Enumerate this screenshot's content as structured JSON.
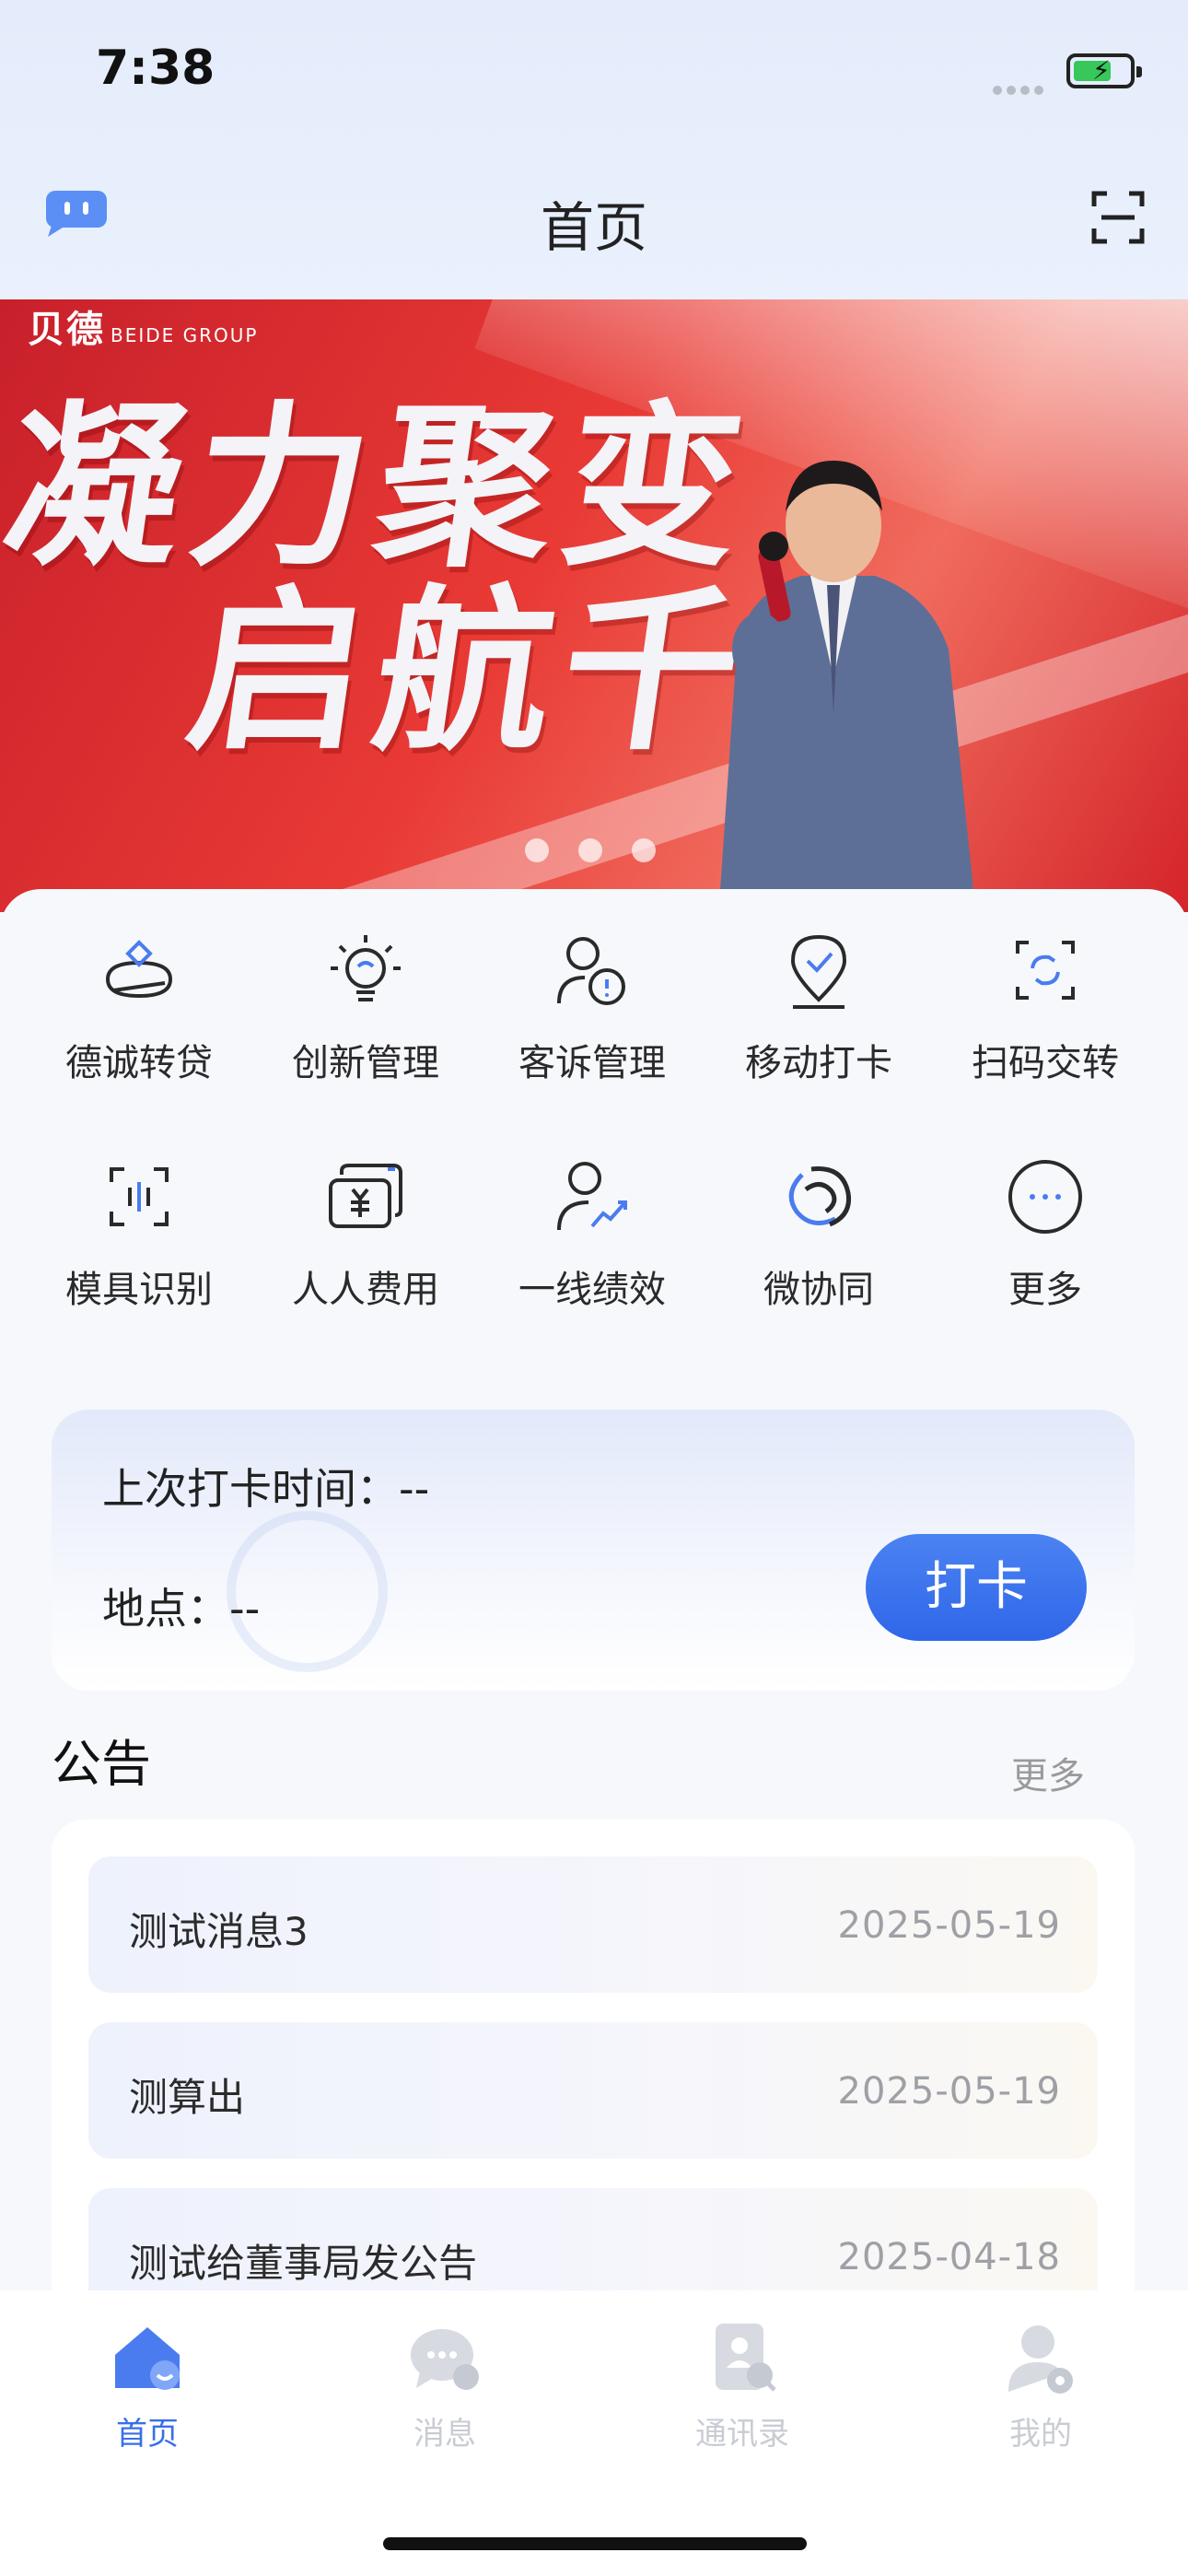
{
  "status": {
    "time": "7:38"
  },
  "header": {
    "title": "首页"
  },
  "banner": {
    "logo": "贝德",
    "logo_sub": "BEIDE GROUP",
    "line1": "凝力聚变",
    "line2": "启航千亿"
  },
  "grid": [
    {
      "label": "德诚转贷",
      "icon": "loan-icon"
    },
    {
      "label": "创新管理",
      "icon": "bulb-icon"
    },
    {
      "label": "客诉管理",
      "icon": "complaint-user-icon"
    },
    {
      "label": "移动打卡",
      "icon": "location-check-icon"
    },
    {
      "label": "扫码交转",
      "icon": "scan-transfer-icon"
    },
    {
      "label": "模具识别",
      "icon": "mold-scan-icon"
    },
    {
      "label": "人人费用",
      "icon": "expense-icon"
    },
    {
      "label": "一线绩效",
      "icon": "performance-icon"
    },
    {
      "label": "微协同",
      "icon": "collaboration-icon"
    },
    {
      "label": "更多",
      "icon": "more-icon"
    }
  ],
  "clock": {
    "last_time_label": "上次打卡时间：--",
    "location_label": "地点：--",
    "button": "打卡"
  },
  "notice": {
    "title": "公告",
    "more": "更多",
    "items": [
      {
        "title": "测试消息3",
        "date": "2025-05-19"
      },
      {
        "title": "测算出",
        "date": "2025-05-19"
      },
      {
        "title": "测试给董事局发公告",
        "date": "2025-04-18"
      }
    ]
  },
  "tabs": [
    {
      "label": "首页",
      "active": true
    },
    {
      "label": "消息",
      "active": false
    },
    {
      "label": "通讯录",
      "active": false
    },
    {
      "label": "我的",
      "active": false
    }
  ],
  "colors": {
    "accent": "#3a6fe8",
    "banner_red": "#d9252b"
  }
}
